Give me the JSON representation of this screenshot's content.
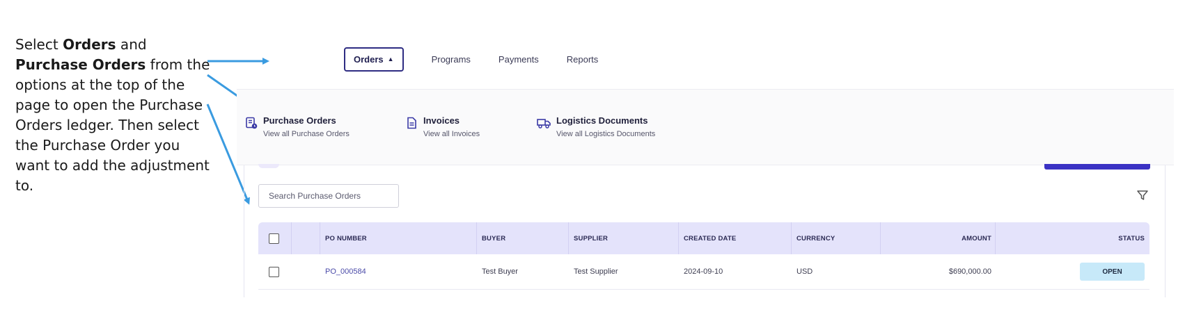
{
  "instructions": {
    "part1": "Select ",
    "bold1": "Orders",
    "part2": " and ",
    "bold2": "Purchase Orders",
    "part3": " from the options at the top of the page to open the Purchase Orders ledger. Then select the Purchase Order you want to add the adjustment to."
  },
  "nav": {
    "orders_label": "Orders",
    "links": [
      "Programs",
      "Payments",
      "Reports"
    ]
  },
  "menu": {
    "items": [
      {
        "title": "Purchase Orders",
        "subtitle": "View all Purchase Orders",
        "icon": "purchase-order-icon"
      },
      {
        "title": "Invoices",
        "subtitle": "View all Invoices",
        "icon": "invoice-icon"
      },
      {
        "title": "Logistics Documents",
        "subtitle": "View all Logistics Documents",
        "icon": "truck-icon"
      }
    ]
  },
  "search": {
    "placeholder": "Search Purchase Orders"
  },
  "table": {
    "headers": {
      "po_number": "PO NUMBER",
      "buyer": "BUYER",
      "supplier": "SUPPLIER",
      "created_date": "CREATED DATE",
      "currency": "CURRENCY",
      "amount": "AMOUNT",
      "status": "STATUS"
    },
    "rows": [
      {
        "po_number": "PO_000584",
        "buyer": "Test Buyer",
        "supplier": "Test Supplier",
        "created_date": "2024-09-10",
        "currency": "USD",
        "amount": "$690,000.00",
        "status": "OPEN"
      }
    ]
  },
  "colors": {
    "accent": "#2e2c82",
    "arrow": "#3a9be0",
    "header_bg": "#e4e3fb",
    "status_bg": "#c7e9f9"
  }
}
